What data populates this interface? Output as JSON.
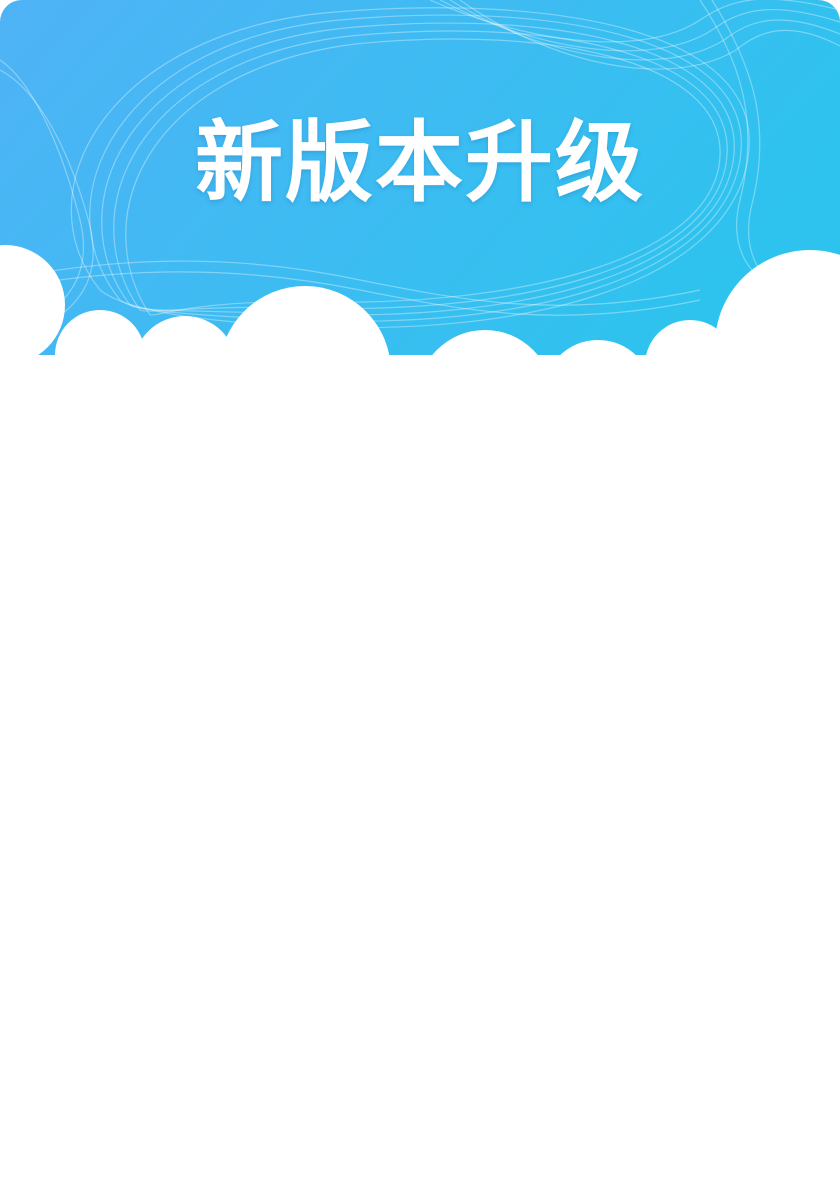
{
  "dialog": {
    "title": "新版本升级"
  },
  "colors": {
    "banner_left": "#4fb3f6",
    "banner_right": "#2ec3ee",
    "cloud": "#ffffff",
    "title_text": "#ffffff",
    "body_background": "#ffffff"
  }
}
